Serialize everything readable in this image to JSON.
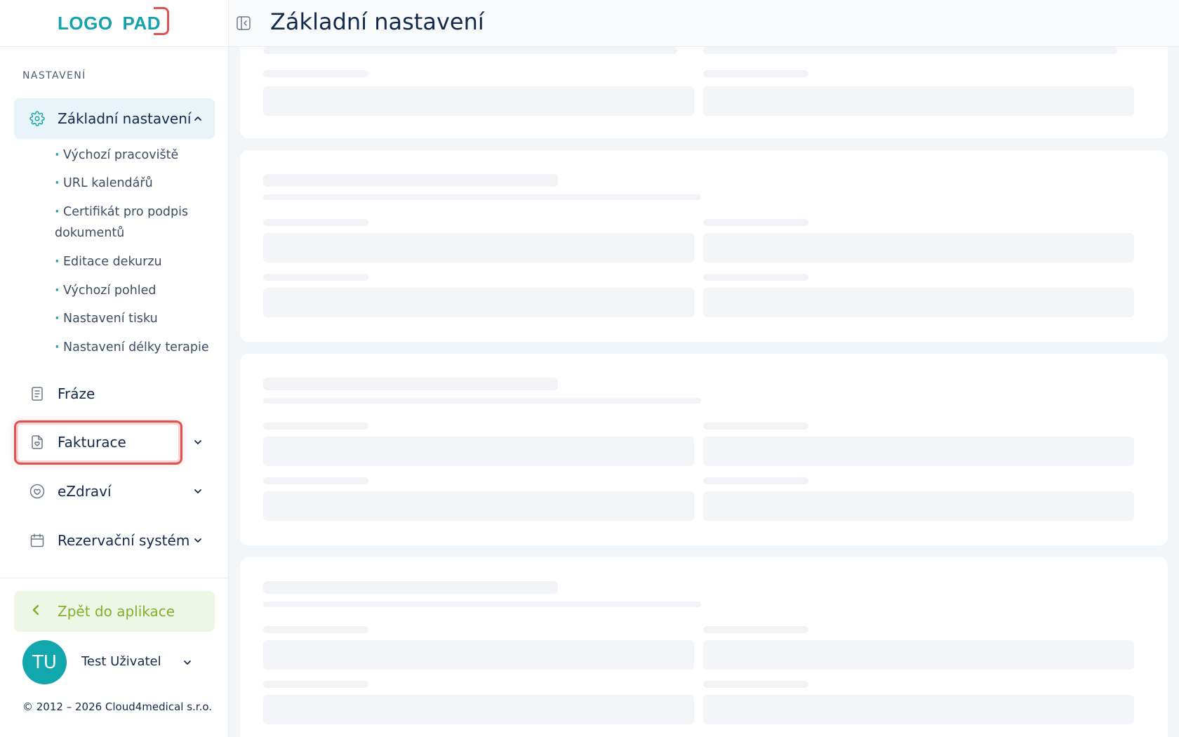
{
  "logo": {
    "part1": "LOGO",
    "part2": "PAD"
  },
  "sidebar": {
    "section_heading": "NASTAVENÍ",
    "active_item": {
      "label": "Základní nastavení",
      "icon": "gear-icon"
    },
    "sub_items": [
      {
        "label": "Výchozí pracoviště"
      },
      {
        "label": "URL kalendářů"
      },
      {
        "label": "Certifikát pro podpis dokumentů"
      },
      {
        "label": "Editace dekurzu"
      },
      {
        "label": "Výchozí pohled"
      },
      {
        "label": "Nastavení tisku"
      },
      {
        "label": "Nastavení délky terapie"
      }
    ],
    "items": [
      {
        "label": "Fráze",
        "icon": "document-icon"
      },
      {
        "label": "Fakturace",
        "icon": "invoice-icon"
      },
      {
        "label": "eZdraví",
        "icon": "heart-icon"
      },
      {
        "label": "Rezervační systém",
        "icon": "calendar-icon"
      }
    ],
    "back_label": "Zpět do aplikace",
    "user": {
      "initials": "TU",
      "name": "Test Uživatel"
    },
    "copyright": "© 2012 – 2026 Cloud4medical s.r.o."
  },
  "header": {
    "title": "Základní nastavení"
  },
  "colors": {
    "accent": "#14a3ac",
    "highlight": "#e0524f",
    "back_green": "#7fb02a",
    "text_dark": "#13294b"
  }
}
